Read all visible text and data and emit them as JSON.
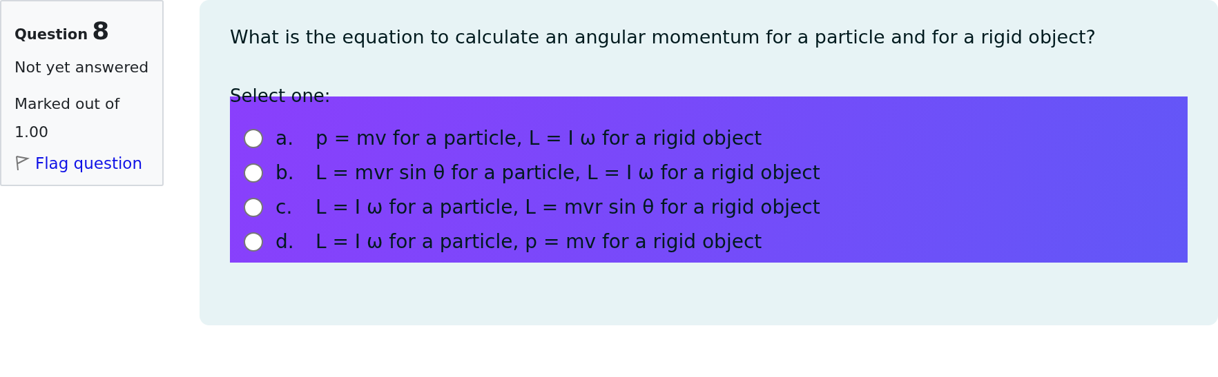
{
  "info": {
    "label": "Question",
    "number": "8",
    "state": "Not yet answered",
    "grade": "Marked out of 1.00",
    "flag": {
      "label": "Flag question",
      "flagged": false
    }
  },
  "question": {
    "text": "What is the equation to calculate an angular momentum for a particle and for a rigid object?",
    "prompt": "Select one:",
    "options": [
      {
        "letter": "a.",
        "text": "p = mv for a particle, L = I ω for a rigid object",
        "selected": false
      },
      {
        "letter": "b.",
        "text": "L = mvr sin θ for a particle, L = I ω for a rigid object",
        "selected": false
      },
      {
        "letter": "c.",
        "text": "L = I ω for a particle, L = mvr sin θ for a rigid object",
        "selected": false
      },
      {
        "letter": "d.",
        "text": "L = I ω for a particle, p = mv for a rigid object",
        "selected": false
      }
    ]
  }
}
